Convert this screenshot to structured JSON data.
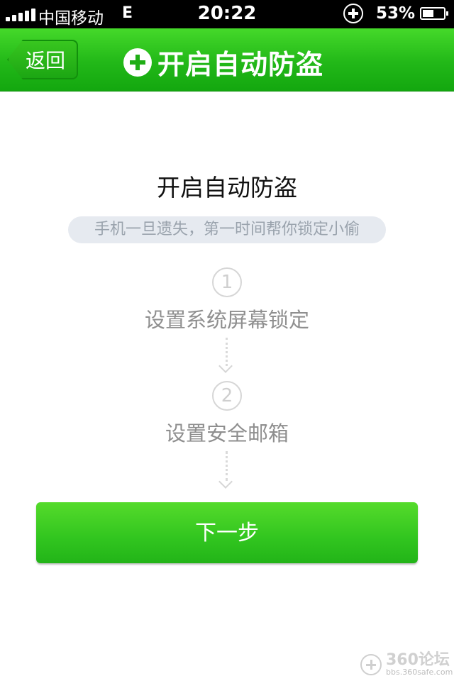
{
  "status_bar": {
    "carrier": "中国移动",
    "network": "E",
    "time": "20:22",
    "battery_percent": "53%",
    "battery_level": 0.53
  },
  "nav": {
    "back_label": "返回",
    "title": "开启自动防盗",
    "icon": "plus-circle-icon"
  },
  "content": {
    "heading": "开启自动防盗",
    "subtitle": "手机一旦遗失，第一时间帮你锁定小偷",
    "steps": [
      {
        "number": "1",
        "label": "设置系统屏幕锁定"
      },
      {
        "number": "2",
        "label": "设置安全邮箱"
      }
    ],
    "next_button": "下一步"
  },
  "watermark": {
    "main": "360论坛",
    "sub": "bbs.360safe.com"
  },
  "colors": {
    "accent_green": "#22b818",
    "button_green": "#31c51f"
  }
}
